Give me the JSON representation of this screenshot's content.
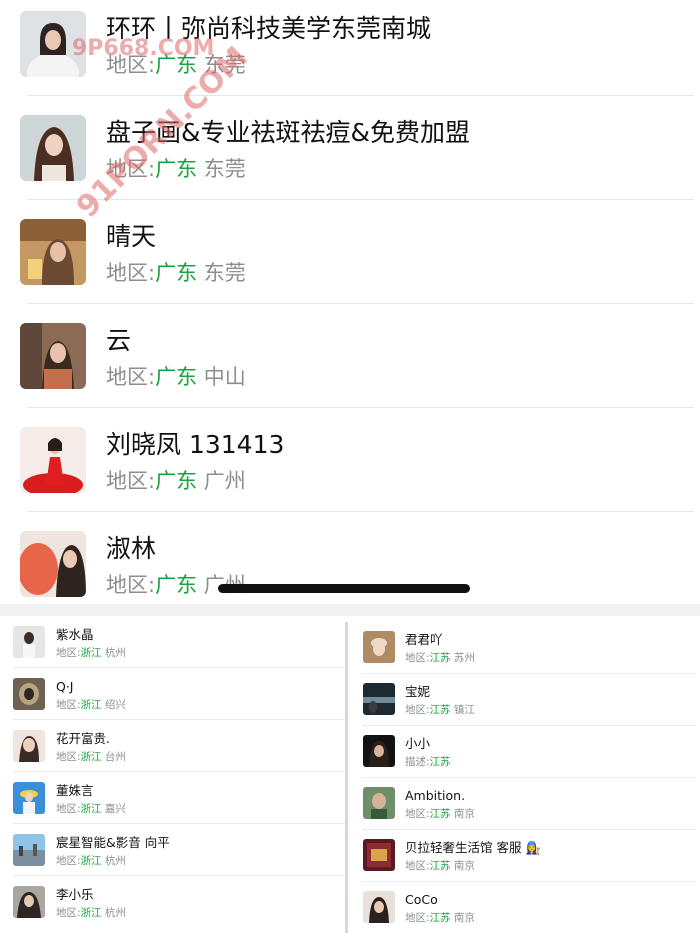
{
  "top_list": [
    {
      "name": "环环丨弥尚科技美学东莞南城",
      "region_label": "地区:",
      "province": "广东",
      "city": "东莞",
      "avatar": "woman-white-suit-avatar"
    },
    {
      "name": "盘子画&专业祛斑祛痘&免费加盟",
      "region_label": "地区:",
      "province": "广东",
      "city": "东莞",
      "avatar": "woman-long-hair-avatar"
    },
    {
      "name": "晴天",
      "region_label": "地区:",
      "province": "广东",
      "city": "东莞",
      "avatar": "woman-drinks-avatar"
    },
    {
      "name": "云",
      "region_label": "地区:",
      "province": "广东",
      "city": "中山",
      "avatar": "woman-floral-avatar"
    },
    {
      "name": "刘晓凤 131413",
      "region_label": "地区:",
      "province": "广东",
      "city": "广州",
      "avatar": "woman-red-dress-avatar"
    },
    {
      "name": "淑林",
      "region_label": "地区:",
      "province": "广东",
      "city": "广州",
      "avatar": "woman-orange-background-avatar"
    }
  ],
  "left_list": [
    {
      "name": "紫水晶",
      "region_label": "地区:",
      "province": "浙江",
      "city": "杭州"
    },
    {
      "name": "Q·J",
      "region_label": "地区:",
      "province": "浙江",
      "city": "绍兴"
    },
    {
      "name": "花开富贵.",
      "region_label": "地区:",
      "province": "浙江",
      "city": "台州"
    },
    {
      "name": "董姝言",
      "region_label": "地区:",
      "province": "浙江",
      "city": "嘉兴"
    },
    {
      "name": "宸星智能&影音 向平",
      "region_label": "地区:",
      "province": "浙江",
      "city": "杭州"
    },
    {
      "name": "李小乐",
      "region_label": "地区:",
      "province": "浙江",
      "city": "杭州"
    }
  ],
  "right_list": [
    {
      "name": "君君吖",
      "region_label": "地区:",
      "province": "江苏",
      "city": "苏州"
    },
    {
      "name": "宝妮",
      "region_label": "地区:",
      "province": "江苏",
      "city": "镇江"
    },
    {
      "name": "小小",
      "region_label": "描述:",
      "province": "江苏",
      "city": ""
    },
    {
      "name": "Ambition.",
      "region_label": "地区:",
      "province": "江苏",
      "city": "南京"
    },
    {
      "name": "贝拉轻奢生活馆 客服 👩‍🔧",
      "region_label": "地区:",
      "province": "江苏",
      "city": "南京"
    },
    {
      "name": "CoCo",
      "region_label": "地区:",
      "province": "江苏",
      "city": "南京"
    }
  ],
  "watermark": {
    "line1": "9P668.COM",
    "line2": "91PORN.COM"
  },
  "colors": {
    "province": "#17a43b",
    "region": "#8e8e8e",
    "name": "#111111",
    "watermark": "#e06a6a"
  }
}
